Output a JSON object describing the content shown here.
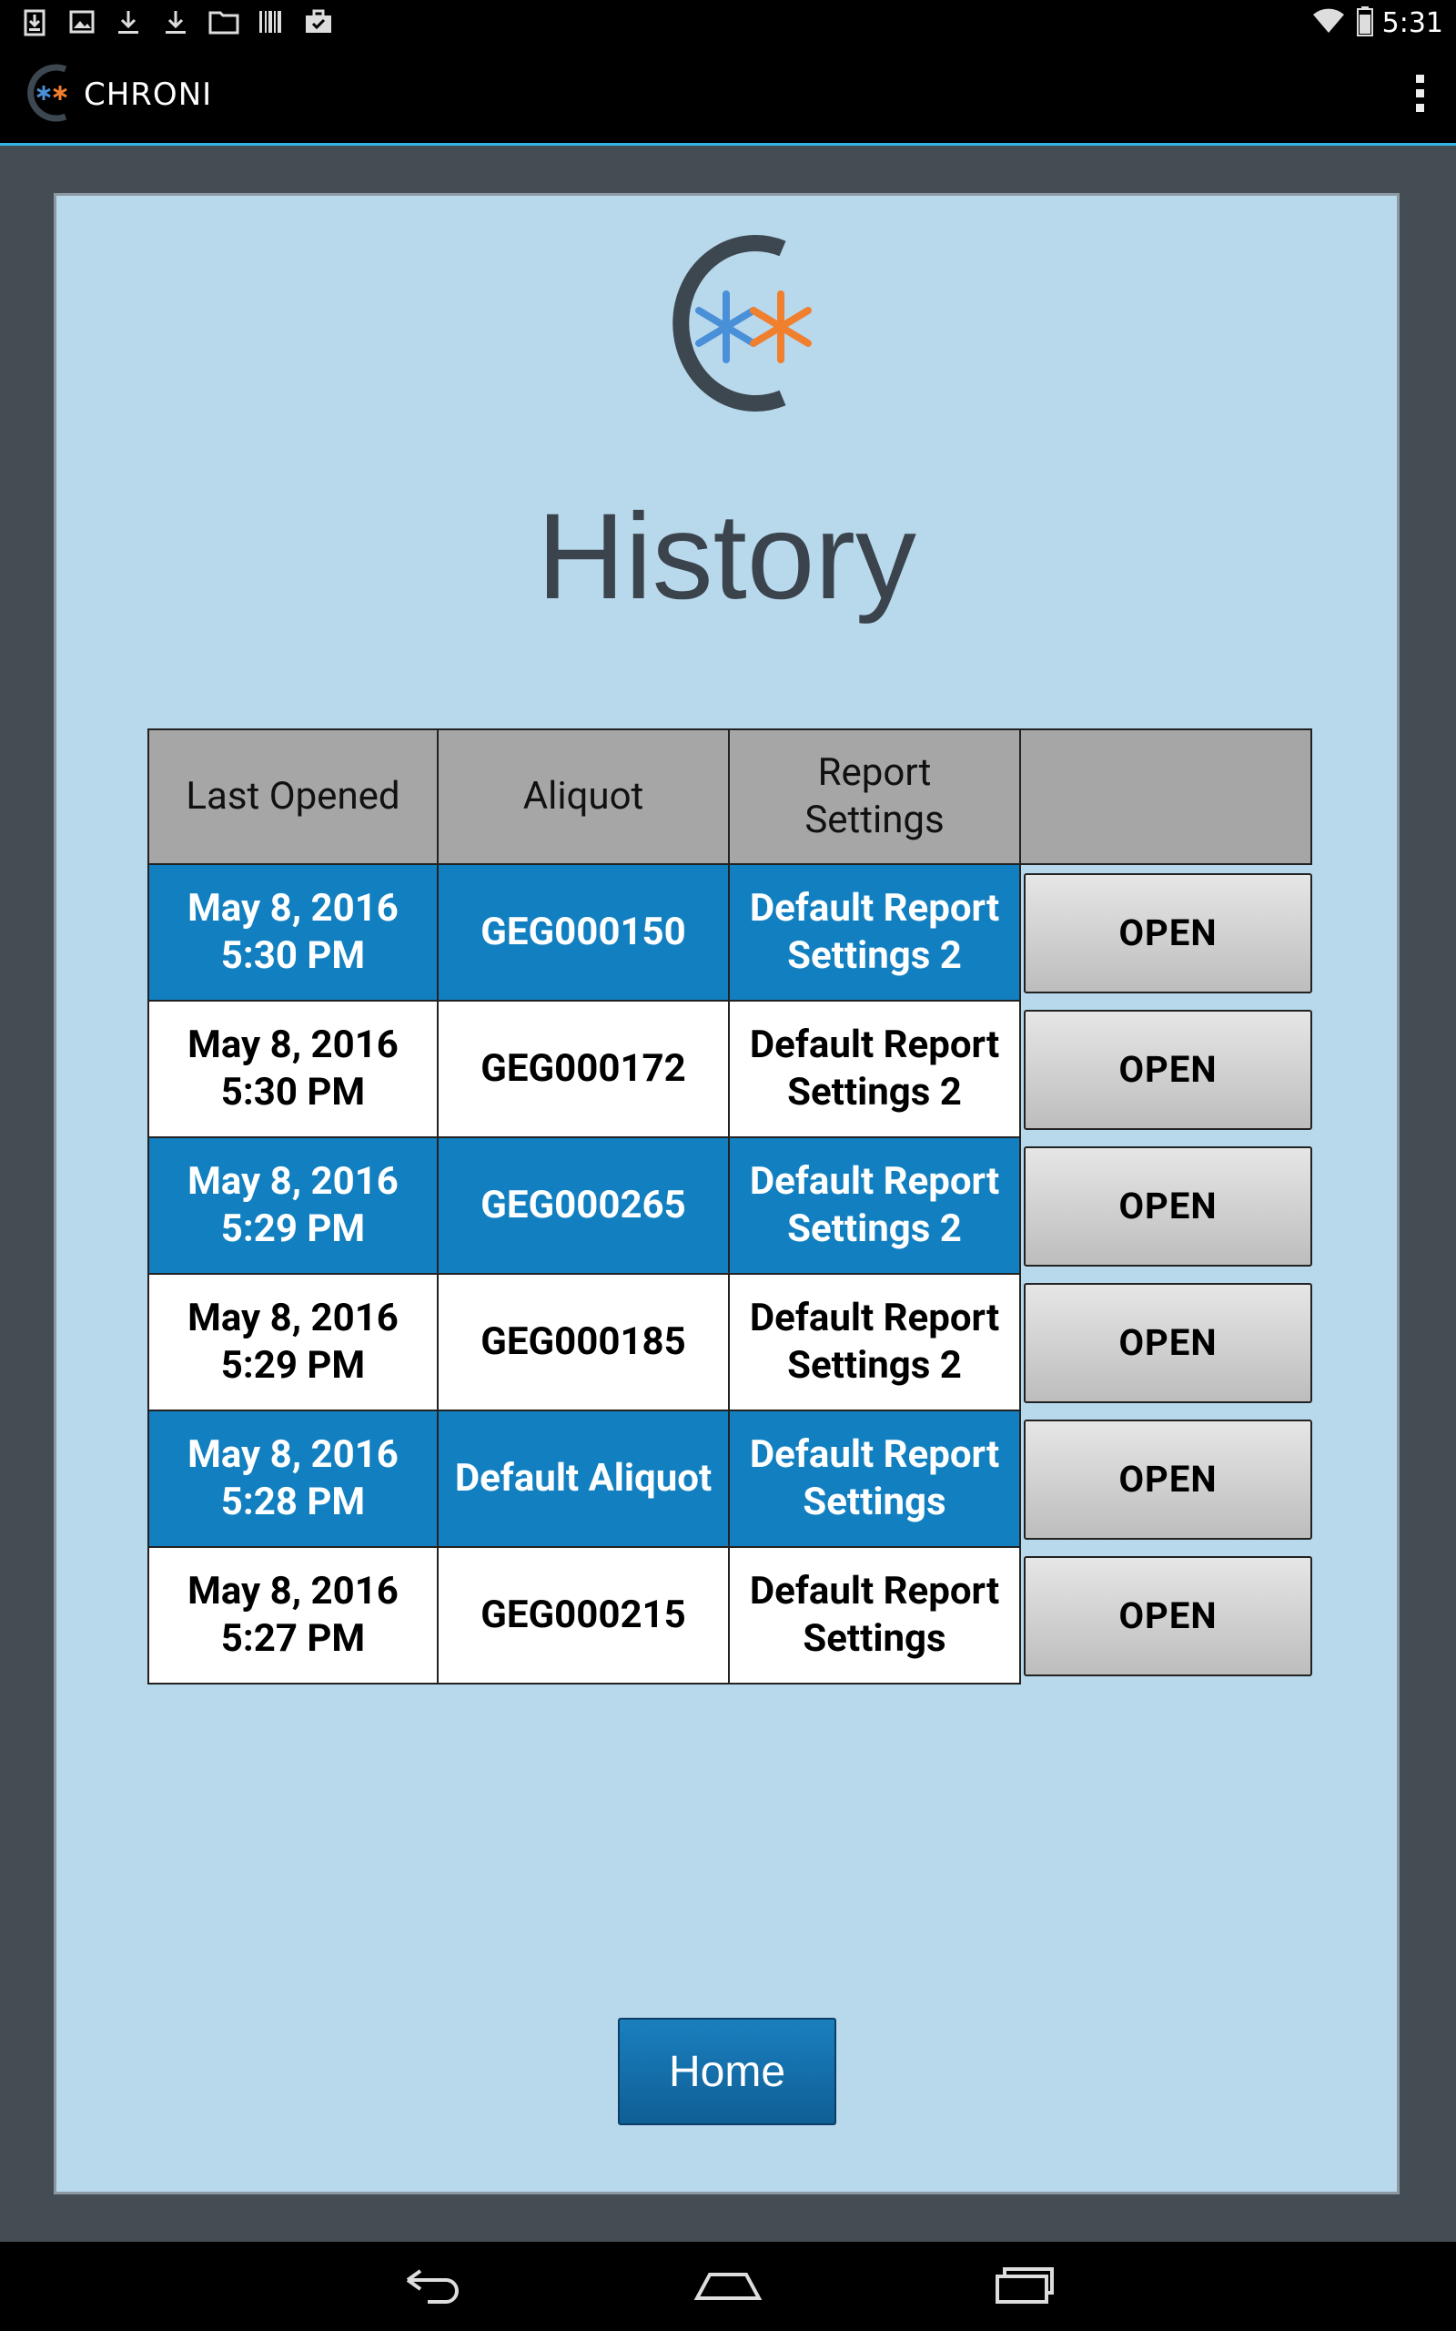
{
  "status_bar": {
    "time": "5:31",
    "left_icons": [
      "download-box-icon",
      "image-icon",
      "download-icon",
      "download-icon",
      "folder-icon",
      "barcode-icon",
      "briefcase-check-icon"
    ],
    "right_icons": [
      "wifi-icon",
      "battery-icon"
    ]
  },
  "action_bar": {
    "title": "CHRONI",
    "menu_icon": "overflow-menu-icon"
  },
  "page": {
    "title": "History"
  },
  "table": {
    "headers": [
      "Last Opened",
      "Aliquot",
      "Report Settings",
      ""
    ],
    "rows": [
      {
        "date": "May 8, 2016",
        "time": "5:30 PM",
        "aliquot": "GEG000150",
        "report_line1": "Default Report",
        "report_line2": "Settings 2",
        "action": "OPEN"
      },
      {
        "date": "May 8, 2016",
        "time": "5:30 PM",
        "aliquot": "GEG000172",
        "report_line1": "Default Report",
        "report_line2": "Settings 2",
        "action": "OPEN"
      },
      {
        "date": "May 8, 2016",
        "time": "5:29 PM",
        "aliquot": "GEG000265",
        "report_line1": "Default Report",
        "report_line2": "Settings 2",
        "action": "OPEN"
      },
      {
        "date": "May 8, 2016",
        "time": "5:29 PM",
        "aliquot": "GEG000185",
        "report_line1": "Default Report",
        "report_line2": "Settings 2",
        "action": "OPEN"
      },
      {
        "date": "May 8, 2016",
        "time": "5:28 PM",
        "aliquot": "Default Aliquot",
        "report_line1": "Default Report",
        "report_line2": "Settings",
        "action": "OPEN"
      },
      {
        "date": "May 8, 2016",
        "time": "5:27 PM",
        "aliquot": "GEG000215",
        "report_line1": "Default Report",
        "report_line2": "Settings",
        "action": "OPEN"
      }
    ]
  },
  "home_button": {
    "label": "Home"
  },
  "nav_bar": {
    "icons": [
      "back-icon",
      "home-icon",
      "recent-apps-icon"
    ]
  },
  "colors": {
    "panel_bg": "#b8d8ec",
    "row_highlight": "#1280c0",
    "accent_line": "#33b5e5",
    "logo_blue": "#4a90d9",
    "logo_orange": "#f07f2e"
  }
}
